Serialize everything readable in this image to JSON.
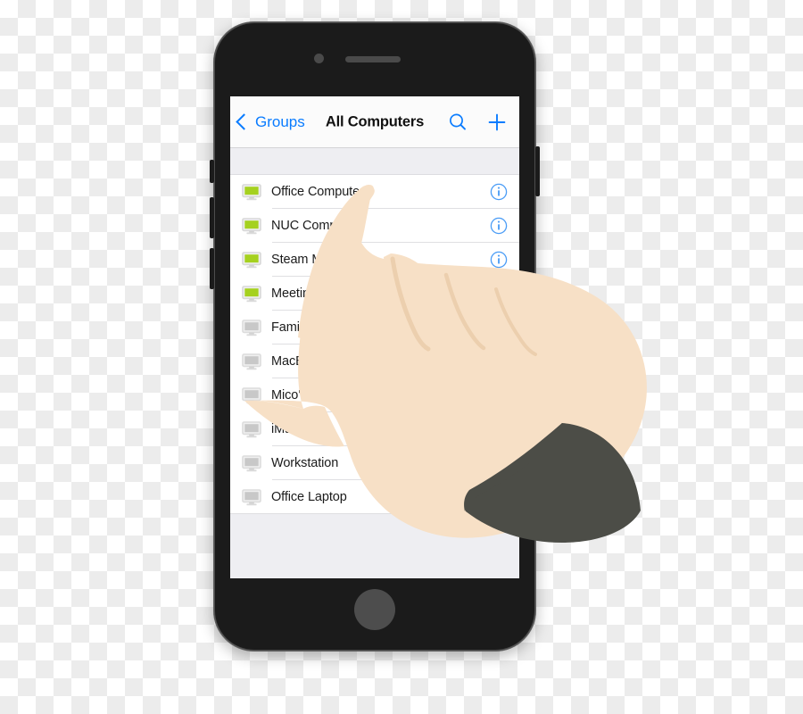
{
  "backdrop": {
    "kind": "transparency-checkerboard",
    "light": "#ffffff",
    "dark": "#ecececec"
  },
  "device": {
    "name": "smartphone-mockup",
    "body_color": "#1b1b1b",
    "home_button_color": "#4d4d4d",
    "buttons": [
      "silent-switch",
      "volume-up",
      "volume-down",
      "power"
    ]
  },
  "navbar": {
    "back_label": "Groups",
    "title": "All Computers",
    "accent_color": "#0a7cff",
    "actions": [
      {
        "icon": "search-icon",
        "label": "Search"
      },
      {
        "icon": "plus-icon",
        "label": "Add"
      }
    ]
  },
  "search_band": {
    "placeholder": ""
  },
  "list": {
    "online_color": "#a5d11f",
    "offline_color": "#c8c8c8",
    "info_color": "#4a9cf6",
    "rows": [
      {
        "label": "Office Computer",
        "icon": "monitor-icon",
        "status": "online",
        "has_info": true
      },
      {
        "label": "NUC Computer",
        "icon": "monitor-icon",
        "status": "online",
        "has_info": true
      },
      {
        "label": "Steam Machine",
        "icon": "monitor-icon",
        "status": "online",
        "has_info": true
      },
      {
        "label": "Meeting Room Computer",
        "icon": "monitor-icon",
        "status": "online",
        "has_info": false
      },
      {
        "label": "Family Laptop",
        "icon": "monitor-icon",
        "status": "offline",
        "has_info": false
      },
      {
        "label": "MacBook Pro",
        "icon": "monitor-icon",
        "status": "offline",
        "has_info": false
      },
      {
        "label": "Mico's",
        "icon": "monitor-icon",
        "status": "offline",
        "has_info": false
      },
      {
        "label": "iMac",
        "icon": "monitor-icon",
        "status": "offline",
        "has_info": false
      },
      {
        "label": "Workstation",
        "icon": "monitor-icon",
        "status": "offline",
        "has_info": false
      },
      {
        "label": "Office Laptop",
        "icon": "monitor-icon",
        "status": "offline",
        "has_info": false
      }
    ]
  },
  "hand": {
    "name": "pointing-hand-illustration",
    "skin_color": "#f7e0c6",
    "skin_shade": "#eccfae",
    "sleeve_color": "#4c4d47",
    "gesture": "index-finger-tap"
  }
}
